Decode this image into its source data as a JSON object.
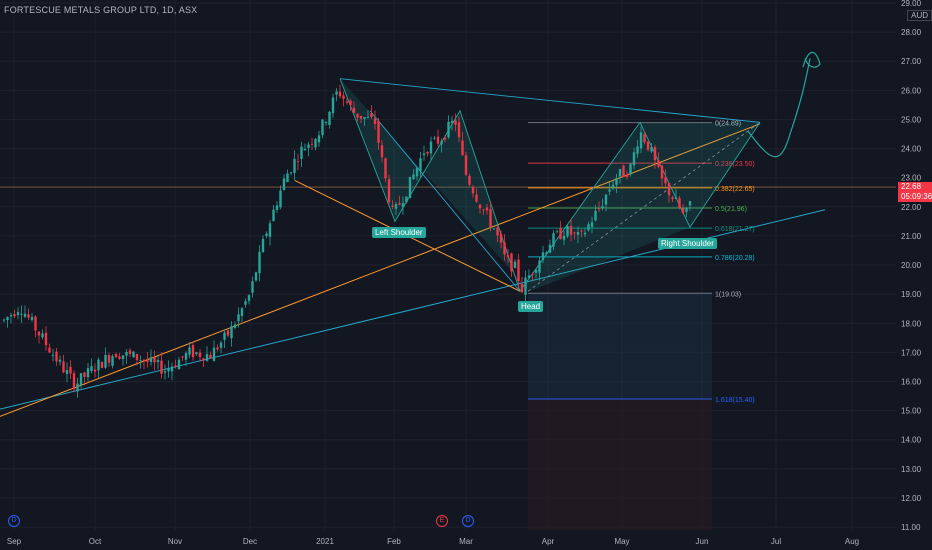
{
  "header": {
    "title": "FORTESCUE METALS GROUP LTD, 1D, ASX",
    "currency": "AUD"
  },
  "price_tag": {
    "price": "22.68",
    "countdown": "05:09:36"
  },
  "annotations": [
    {
      "key": "left_shoulder",
      "text": "Left Shoulder"
    },
    {
      "key": "head",
      "text": "Head"
    },
    {
      "key": "right_shoulder",
      "text": "Right Shoulder"
    }
  ],
  "events": [
    {
      "key": "d1",
      "text": "D"
    },
    {
      "key": "e1",
      "text": "E"
    },
    {
      "key": "d2",
      "text": "D"
    }
  ],
  "colors": {
    "background": "#131722",
    "up": "#26a69a",
    "down": "#f23645",
    "grid": "#1e222d",
    "axis_text": "#b2b5be",
    "teal_line": "#26a6c9",
    "orange_line": "#ff9a2e",
    "projection": "#26a69a"
  },
  "chart_data": {
    "type": "candlestick",
    "ylim": [
      10.9,
      29.0
    ],
    "y_ticks": [
      11.0,
      12.0,
      13.0,
      14.0,
      15.0,
      16.0,
      17.0,
      18.0,
      19.0,
      20.0,
      21.0,
      22.0,
      23.0,
      24.0,
      25.0,
      26.0,
      27.0,
      28.0,
      29.0
    ],
    "x_ticks": [
      "Sep",
      "Oct",
      "Nov",
      "Dec",
      "2021",
      "Feb",
      "Mar",
      "Apr",
      "May",
      "Jun",
      "Jul",
      "Aug"
    ],
    "current_price": 22.68,
    "fibonacci": [
      {
        "level": "0",
        "value": 24.89
      },
      {
        "level": "0.236",
        "value": 23.5
      },
      {
        "level": "0.382",
        "value": 22.65
      },
      {
        "level": "0.5",
        "value": 21.96
      },
      {
        "level": "0.618",
        "value": 21.27
      },
      {
        "level": "0.786",
        "value": 20.28
      },
      {
        "level": "1",
        "value": 19.03
      },
      {
        "level": "1.618",
        "value": 15.4
      }
    ],
    "candles_approx": [
      {
        "d": "Sep",
        "c": 18.3
      },
      {
        "d": "Oct",
        "c": 16.0
      },
      {
        "d": "Nov",
        "c": 16.5
      },
      {
        "d": "Dec",
        "c": 19.5
      },
      {
        "d": "2021",
        "c": 25.5
      },
      {
        "d": "Feb",
        "c": 21.9
      },
      {
        "d": "Mar",
        "c": 23.0
      },
      {
        "d": "Mar",
        "c": 19.1
      },
      {
        "d": "Apr",
        "c": 20.8
      },
      {
        "d": "May",
        "c": 24.6
      },
      {
        "d": "Jun",
        "c": 22.68
      }
    ]
  }
}
